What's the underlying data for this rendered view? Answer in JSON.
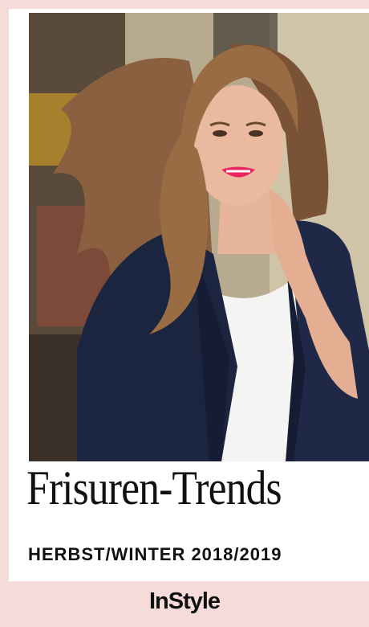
{
  "headline": "Frisuren-Trends",
  "subline": "HERBST/WINTER 2018/2019",
  "brand": "InStyle",
  "colors": {
    "background": "#f6dcd8",
    "card": "#ffffff",
    "text": "#111111",
    "blazer": "#1c2540",
    "hair": "#9a6c44",
    "lips": "#e8255e"
  }
}
